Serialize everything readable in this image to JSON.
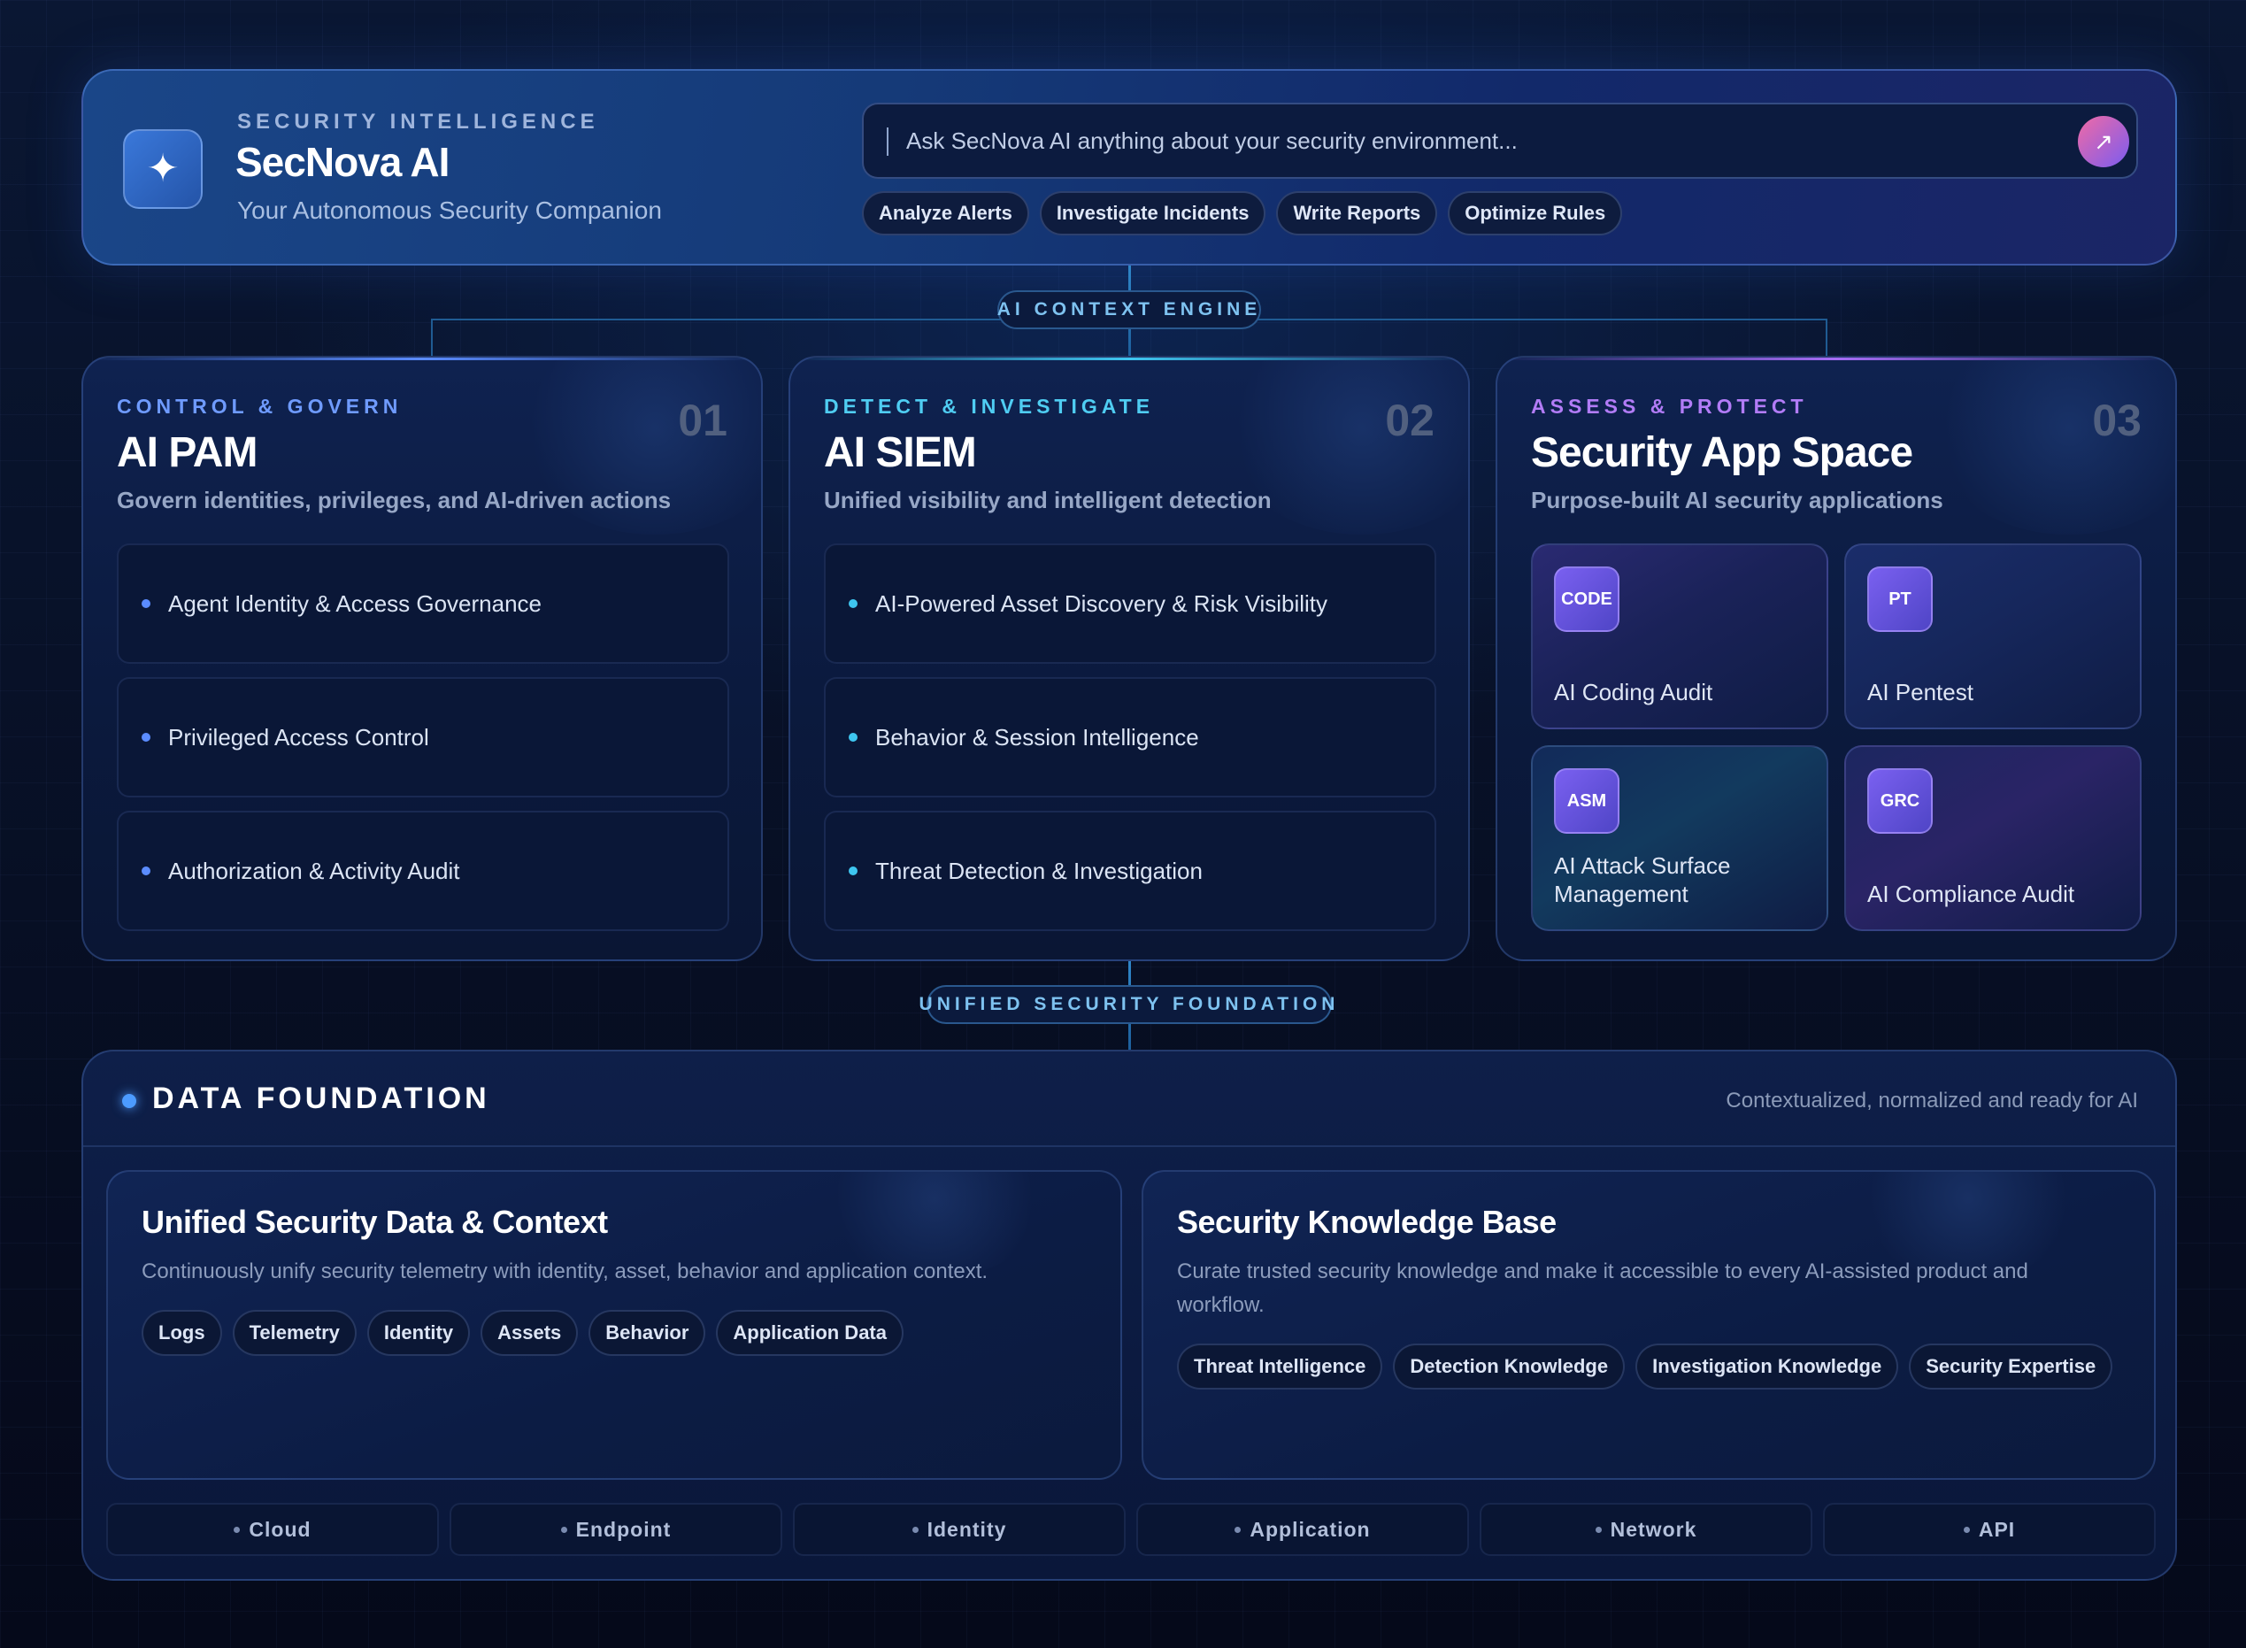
{
  "header": {
    "eyebrow": "SECURITY INTELLIGENCE",
    "title": "SecNova AI",
    "subtitle": "Your Autonomous Security Companion",
    "logo_icon": "sparkle-icon",
    "ask_placeholder": "Ask SecNova AI anything about your security environment...",
    "send_icon": "arrow-up-right-icon",
    "quick_actions": [
      "Analyze Alerts",
      "Investigate Incidents",
      "Write Reports",
      "Optimize Rules"
    ]
  },
  "connectors": {
    "top": "AI CONTEXT ENGINE",
    "bottom": "UNIFIED SECURITY FOUNDATION"
  },
  "columns": [
    {
      "eyebrow": "CONTROL & GOVERN",
      "number": "01",
      "title": "AI PAM",
      "subtitle": "Govern identities, privileges, and AI-driven actions",
      "accent": "#5b8cff",
      "items": [
        "Agent Identity & Access Governance",
        "Privileged Access Control",
        "Authorization & Activity Audit"
      ]
    },
    {
      "eyebrow": "DETECT & INVESTIGATE",
      "number": "02",
      "title": "AI SIEM",
      "subtitle": "Unified visibility and intelligent detection",
      "accent": "#3ec6f0",
      "items": [
        "AI-Powered Asset Discovery & Risk Visibility",
        "Behavior & Session Intelligence",
        "Threat Detection & Investigation"
      ]
    },
    {
      "eyebrow": "ASSESS & PROTECT",
      "number": "03",
      "title": "Security App Space",
      "subtitle": "Purpose-built AI security applications",
      "accent": "#a66cf5",
      "apps": [
        {
          "badge": "CODE",
          "name": "AI Coding Audit"
        },
        {
          "badge": "PT",
          "name": "AI Pentest"
        },
        {
          "badge": "ASM",
          "name": "AI Attack Surface Management"
        },
        {
          "badge": "GRC",
          "name": "AI Compliance Audit"
        }
      ]
    }
  ],
  "foundation": {
    "title": "DATA FOUNDATION",
    "tagline": "Contextualized, normalized and ready for AI",
    "cards": [
      {
        "title": "Unified Security Data & Context",
        "description": "Continuously unify security telemetry with identity, asset, behavior and application context.",
        "tags": [
          "Logs",
          "Telemetry",
          "Identity",
          "Assets",
          "Behavior",
          "Application Data"
        ]
      },
      {
        "title": "Security Knowledge Base",
        "description": "Curate trusted security knowledge and make it accessible to every AI-assisted product and workflow.",
        "tags": [
          "Threat Intelligence",
          "Detection Knowledge",
          "Investigation Knowledge",
          "Security Expertise"
        ]
      }
    ],
    "sources": [
      "Cloud",
      "Endpoint",
      "Identity",
      "Application",
      "Network",
      "API"
    ]
  }
}
